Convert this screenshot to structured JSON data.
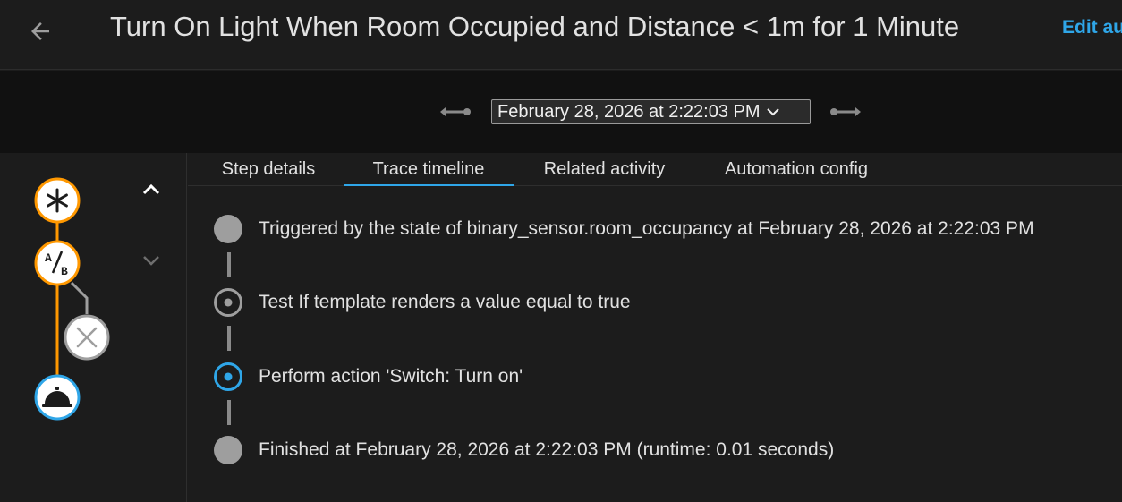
{
  "header": {
    "title": "Turn On Light When Room Occupied and Distance < 1m for 1 Minute",
    "edit_label": "Edit au"
  },
  "trace_selector": {
    "selected": "February 28, 2026 at 2:22:03 PM"
  },
  "tabs": [
    {
      "label": "Step details",
      "active": false
    },
    {
      "label": "Trace timeline",
      "active": true
    },
    {
      "label": "Related activity",
      "active": false
    },
    {
      "label": "Automation config",
      "active": false
    }
  ],
  "graph": {
    "nodes": [
      "trigger-node",
      "condition-node",
      "condition-fail-node",
      "action-node"
    ],
    "active_color": "#ff9800",
    "inactive_color": "#9e9e9e",
    "selected_ring": "#2fa6e8"
  },
  "timeline": [
    {
      "text": "Triggered by the state of binary_sensor.room_occupancy at February 28, 2026 at 2:22:03 PM",
      "icon": "filled-dot"
    },
    {
      "text": "Test If template renders a value equal to true",
      "icon": "ring-dot"
    },
    {
      "text": "Perform action 'Switch: Turn on'",
      "icon": "ring-dot-active"
    },
    {
      "text": "Finished at February 28, 2026 at 2:22:03 PM (runtime: 0.01 seconds)",
      "icon": "filled-dot"
    }
  ],
  "colors": {
    "accent": "#2fa6e8",
    "background": "#1c1c1c",
    "header_band": "#111111"
  }
}
